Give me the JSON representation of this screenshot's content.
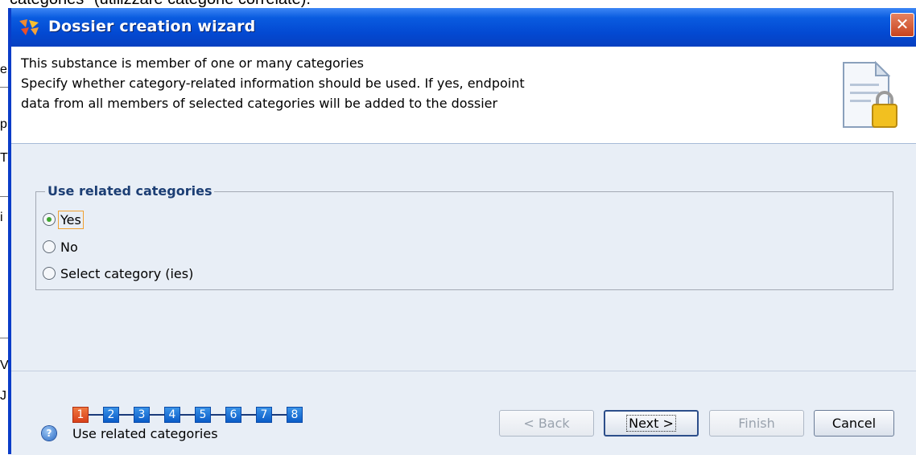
{
  "background_doc": {
    "top_text": "categories\" (utilizzare categorie correlate).",
    "edge_letters": [
      "e",
      "p",
      "T",
      "i",
      "V",
      "J"
    ]
  },
  "window": {
    "title": "Dossier creation wizard",
    "close_label": "✕"
  },
  "header": {
    "line1": "This substance is member of one or many categories",
    "line2": "Specify whether category-related information should be used. If yes, endpoint",
    "line3": "data from all members of selected categories will be added to the dossier",
    "icon": "document-lock-icon"
  },
  "group": {
    "title": "Use related categories",
    "options": [
      {
        "label": "Yes",
        "checked": true
      },
      {
        "label": "No",
        "checked": false
      },
      {
        "label": "Select category (ies)",
        "checked": false
      }
    ]
  },
  "footer": {
    "help_icon": "?",
    "steps": [
      "1",
      "2",
      "3",
      "4",
      "5",
      "6",
      "7",
      "8"
    ],
    "active_step": 1,
    "step_caption": "Use related categories",
    "buttons": {
      "back": "< Back",
      "next": "Next >",
      "finish": "Finish",
      "cancel": "Cancel"
    }
  },
  "colors": {
    "titlebar": "#0349d2",
    "active_step": "#d8401a",
    "step": "#0a5cc8",
    "group_title": "#1c3e74"
  }
}
